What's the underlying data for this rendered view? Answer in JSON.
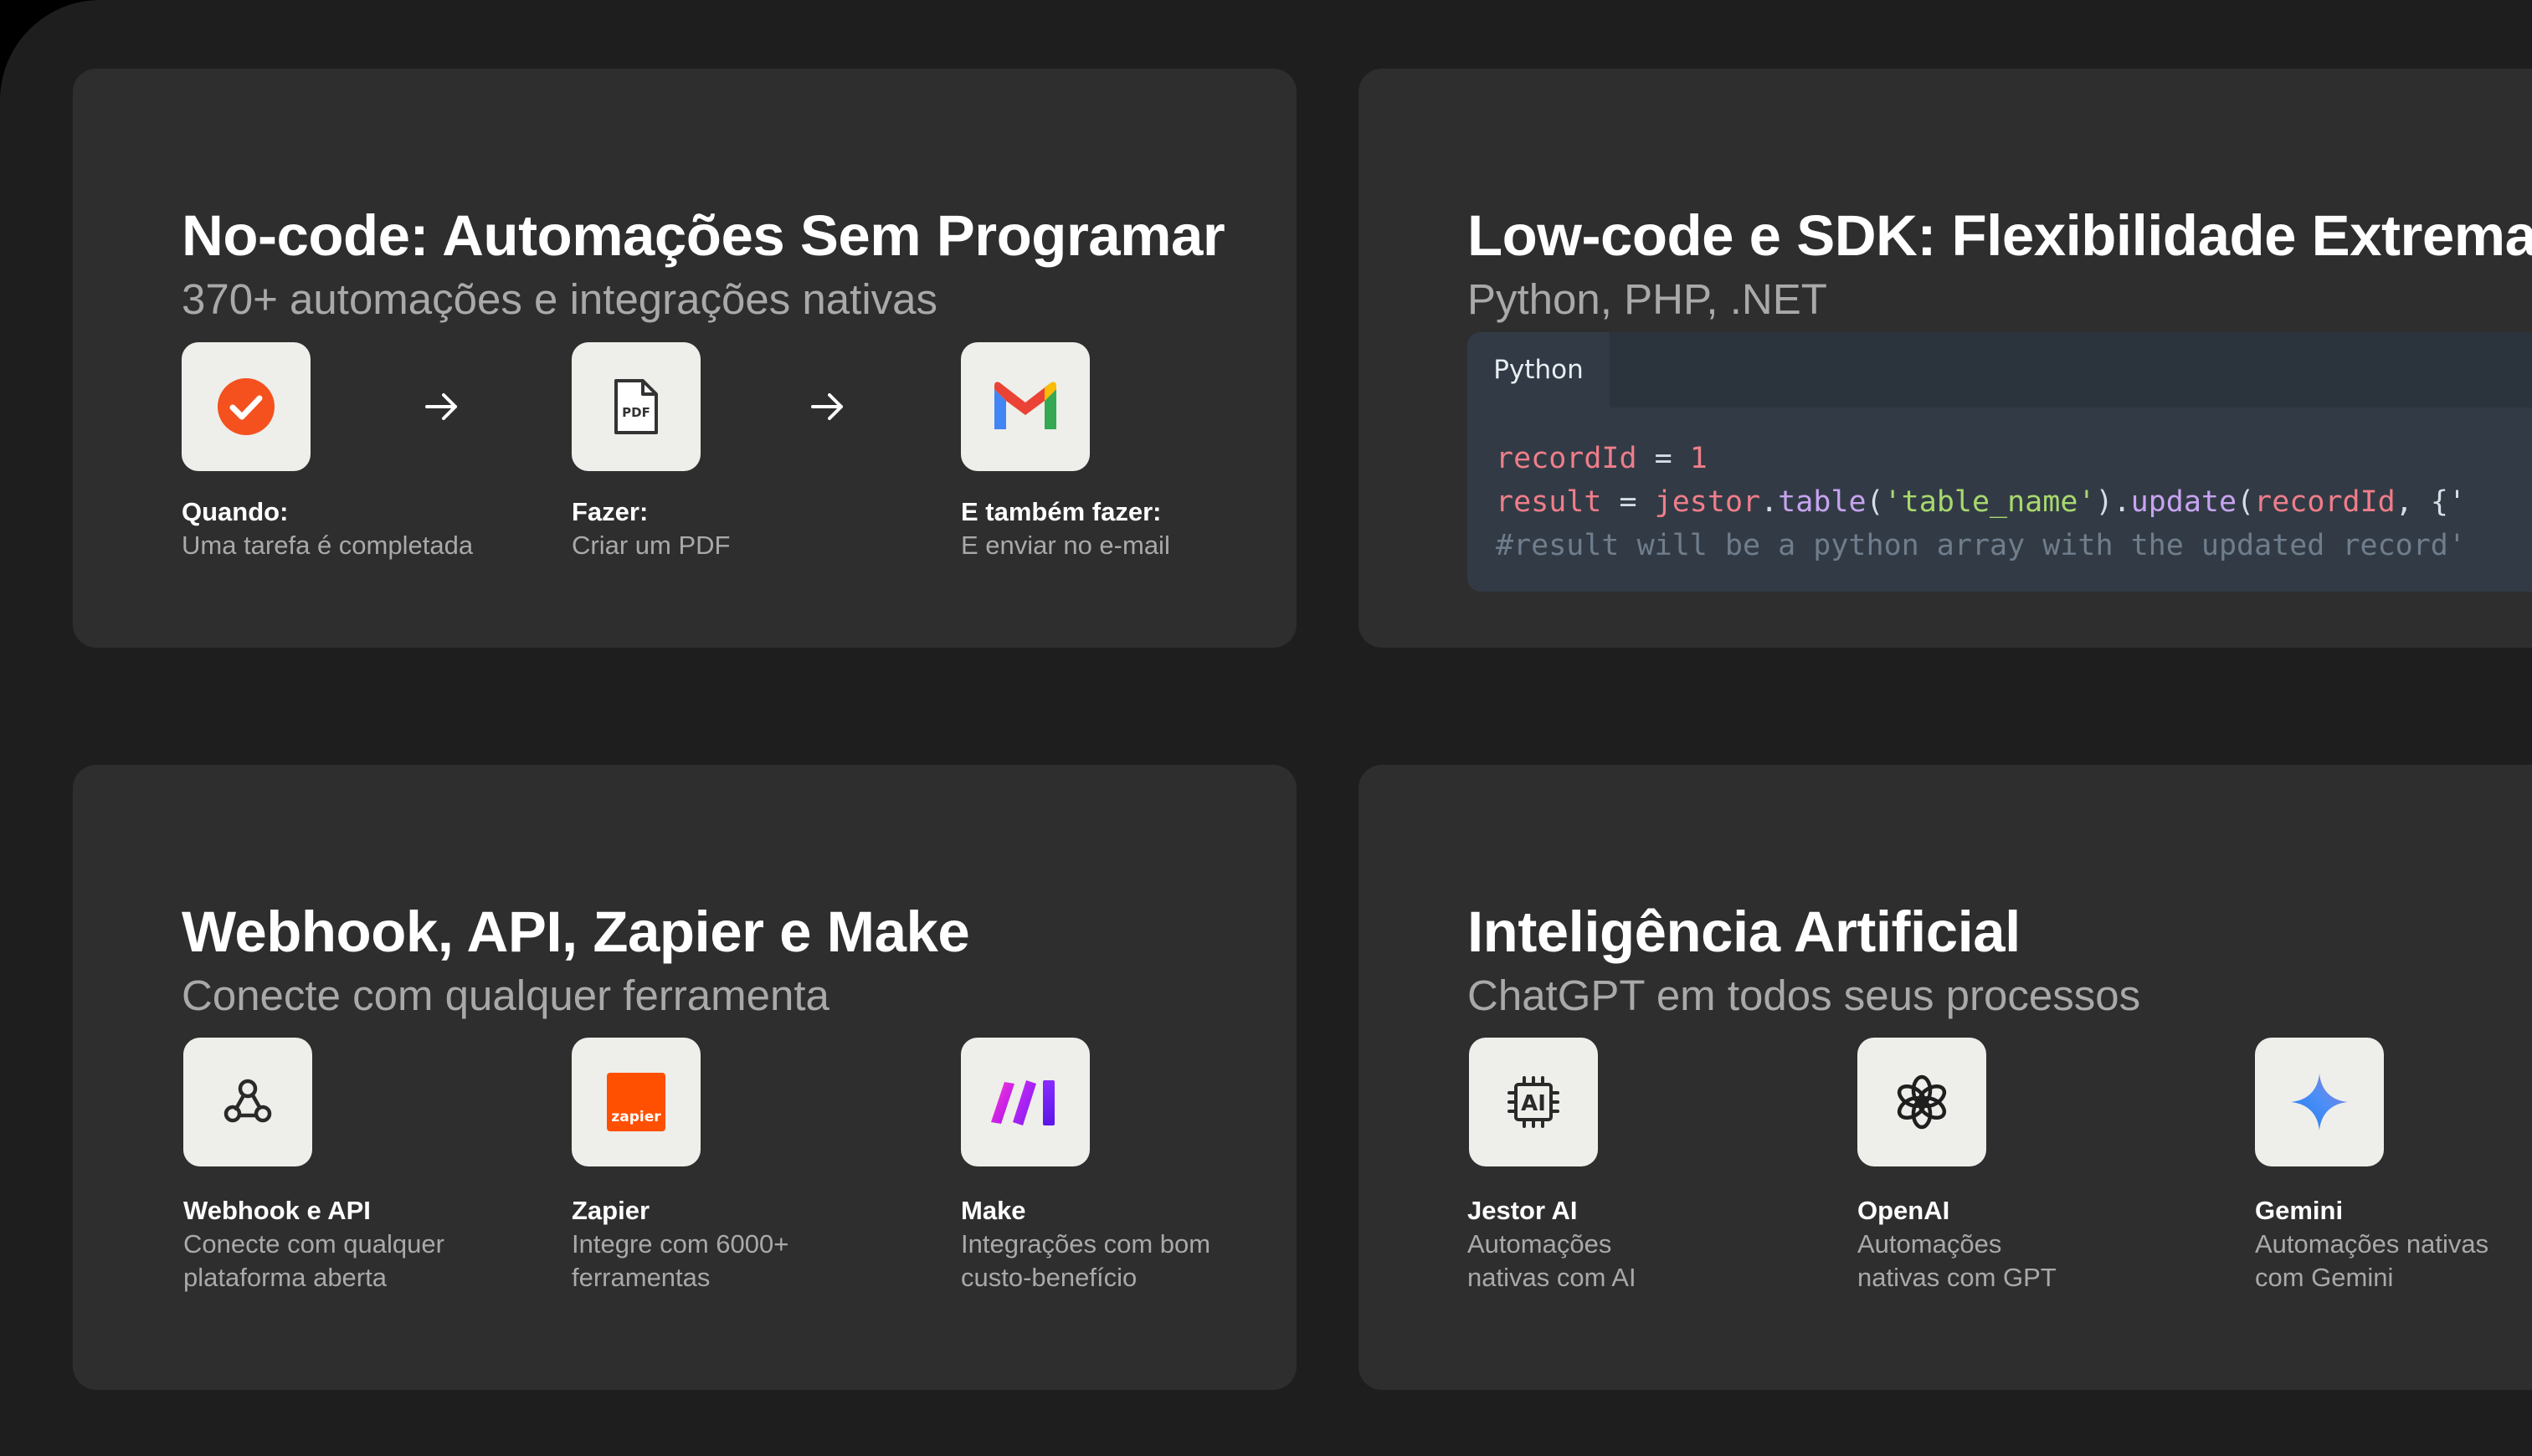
{
  "cards": {
    "nocode": {
      "title": "No-code: Automações Sem Programar",
      "subtitle": "370+ automações e integrações nativas",
      "steps": [
        {
          "icon": "check-circle-icon",
          "title": "Quando:",
          "desc": "Uma tarefa é completada"
        },
        {
          "icon": "pdf-file-icon",
          "pdf_text": "PDF",
          "title": "Fazer:",
          "desc": "Criar um PDF"
        },
        {
          "icon": "gmail-icon",
          "title": "E também fazer:",
          "desc": "E enviar no e-mail"
        }
      ]
    },
    "lowcode": {
      "title": "Low-code e SDK: Flexibilidade Extrema",
      "subtitle": "Python, PHP, .NET",
      "code": {
        "tab": "Python",
        "line1": {
          "var": "recordId",
          "op": " = ",
          "num": "1"
        },
        "line2": {
          "var": "result",
          "op": " = ",
          "obj": "jestor",
          "dot1": ".",
          "fn1": "table",
          "p1": "(",
          "str": "'table_name'",
          "p2": ")",
          "dot2": ".",
          "fn2": "update",
          "p3": "(",
          "arg": "recordId",
          "rest": ", {'"
        },
        "line3": "#result will be a python array with the updated record'"
      }
    },
    "webhook": {
      "title": "Webhook, API, Zapier e Make",
      "subtitle": "Conecte com qualquer ferramenta",
      "items": [
        {
          "icon": "webhook-icon",
          "title": "Webhook e API",
          "desc": "Conecte com qualquer\nplataforma aberta"
        },
        {
          "icon": "zapier-icon",
          "logo_text": "zapier",
          "title": "Zapier",
          "desc": "Integre com 6000+\nferramentas"
        },
        {
          "icon": "make-icon",
          "title": "Make",
          "desc": "Integrações com bom\ncusto-benefício"
        }
      ]
    },
    "ai": {
      "title": "Inteligência Artificial",
      "subtitle": "ChatGPT em todos seus processos",
      "items": [
        {
          "icon": "ai-chip-icon",
          "chip_text": "AI",
          "title": "Jestor AI",
          "desc": "Automações\nnativas com AI"
        },
        {
          "icon": "openai-icon",
          "title": "OpenAI",
          "desc": "Automações\nnativas com GPT"
        },
        {
          "icon": "gemini-icon",
          "title": "Gemini",
          "desc": "Automações nativas\ncom Gemini"
        }
      ]
    }
  },
  "colors": {
    "background": "#1e1e1e",
    "card": "#2e2e2e",
    "title": "#ffffff",
    "subtitle": "#a9a9a9",
    "tile": "#eeeeea",
    "check_orange": "#f4511e",
    "zapier_orange": "#ff4f00"
  }
}
